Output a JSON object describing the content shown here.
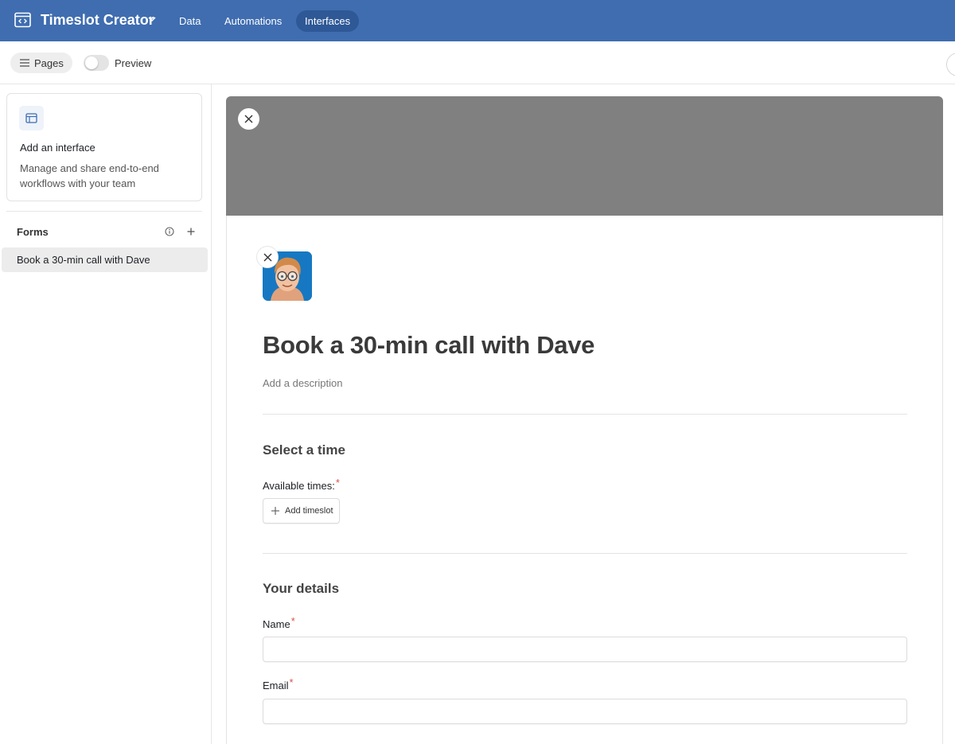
{
  "header": {
    "app_icon": "interface-window-icon",
    "app_title": "Timeslot Creator",
    "tabs": [
      {
        "label": "Data",
        "active": false
      },
      {
        "label": "Automations",
        "active": false
      },
      {
        "label": "Interfaces",
        "active": true
      }
    ],
    "colors": {
      "bar": "#3f6db0",
      "active_tab": "#2e5896"
    }
  },
  "toolbar": {
    "pages_label": "Pages",
    "preview_label": "Preview",
    "preview_on": false
  },
  "sidebar": {
    "add_card": {
      "title": "Add an interface",
      "description": "Manage and share end-to-end workflows with your team"
    },
    "section_label": "Forms",
    "items": [
      {
        "label": "Book a 30-min call with Dave",
        "selected": true
      }
    ]
  },
  "form": {
    "title": "Book a 30-min call with Dave",
    "description_placeholder": "Add a description",
    "sections": [
      {
        "title": "Select a time",
        "fields": [
          {
            "label": "Available times:",
            "required": true,
            "button_label": "Add timeslot"
          }
        ]
      },
      {
        "title": "Your details",
        "fields": [
          {
            "label": "Name",
            "required": true,
            "value": ""
          },
          {
            "label": "Email",
            "required": true,
            "value": ""
          }
        ]
      }
    ],
    "required_marker": "*",
    "colors": {
      "cover": "#808080",
      "logo_bg": "#1678c2",
      "required": "#d9534f"
    }
  }
}
